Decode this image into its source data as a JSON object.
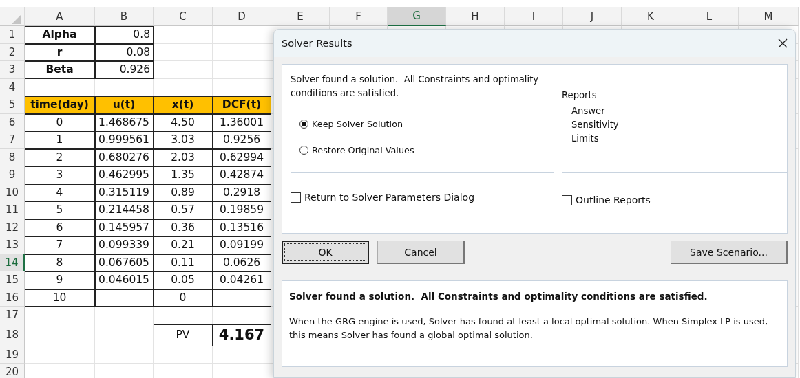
{
  "sheet": {
    "columns": [
      {
        "label": "A",
        "selected": false
      },
      {
        "label": "B",
        "selected": false
      },
      {
        "label": "C",
        "selected": false
      },
      {
        "label": "D",
        "selected": false
      },
      {
        "label": "E",
        "selected": false
      },
      {
        "label": "F",
        "selected": false
      },
      {
        "label": "G",
        "selected": true
      },
      {
        "label": "H",
        "selected": false
      },
      {
        "label": "I",
        "selected": false
      },
      {
        "label": "J",
        "selected": false
      },
      {
        "label": "K",
        "selected": false
      },
      {
        "label": "L",
        "selected": false
      },
      {
        "label": "M",
        "selected": false
      }
    ],
    "rows": [
      {
        "number": "1",
        "kind": "param",
        "selected": false,
        "a": "Alpha",
        "b": "0.8"
      },
      {
        "number": "2",
        "kind": "param",
        "selected": false,
        "a": "r",
        "b": "0.08"
      },
      {
        "number": "3",
        "kind": "param",
        "selected": false,
        "a": "Beta",
        "b": "0.926"
      },
      {
        "number": "4",
        "kind": "blank",
        "selected": false
      },
      {
        "number": "5",
        "kind": "header",
        "selected": false,
        "a": "time(day)",
        "b": "u(t)",
        "c": "x(t)",
        "d": "DCF(t)"
      },
      {
        "number": "6",
        "kind": "data",
        "selected": false,
        "a": "0",
        "b": "1.468675",
        "c": "4.50",
        "d": "1.36001"
      },
      {
        "number": "7",
        "kind": "data",
        "selected": false,
        "a": "1",
        "b": "0.999561",
        "c": "3.03",
        "d": "0.9256"
      },
      {
        "number": "8",
        "kind": "data",
        "selected": false,
        "a": "2",
        "b": "0.680276",
        "c": "2.03",
        "d": "0.62994"
      },
      {
        "number": "9",
        "kind": "data",
        "selected": false,
        "a": "3",
        "b": "0.462995",
        "c": "1.35",
        "d": "0.42874"
      },
      {
        "number": "10",
        "kind": "data",
        "selected": false,
        "a": "4",
        "b": "0.315119",
        "c": "0.89",
        "d": "0.2918"
      },
      {
        "number": "11",
        "kind": "data",
        "selected": false,
        "a": "5",
        "b": "0.214458",
        "c": "0.57",
        "d": "0.19859"
      },
      {
        "number": "12",
        "kind": "data",
        "selected": false,
        "a": "6",
        "b": "0.145957",
        "c": "0.36",
        "d": "0.13516"
      },
      {
        "number": "13",
        "kind": "data",
        "selected": false,
        "a": "7",
        "b": "0.099339",
        "c": "0.21",
        "d": "0.09199"
      },
      {
        "number": "14",
        "kind": "data",
        "selected": true,
        "a": "8",
        "b": "0.067605",
        "c": "0.11",
        "d": "0.0626"
      },
      {
        "number": "15",
        "kind": "data",
        "selected": false,
        "a": "9",
        "b": "0.046015",
        "c": "0.05",
        "d": "0.04261"
      },
      {
        "number": "16",
        "kind": "data",
        "selected": false,
        "a": "10",
        "c": "0"
      },
      {
        "number": "17",
        "kind": "blank",
        "selected": false
      },
      {
        "number": "18",
        "kind": "total",
        "selected": false,
        "c": "PV",
        "d": "4.167"
      },
      {
        "number": "19",
        "kind": "blank",
        "selected": false
      },
      {
        "number": "20",
        "kind": "blank",
        "selected": false
      }
    ]
  },
  "dialog": {
    "title": "Solver Results",
    "message": "Solver found a solution.  All Constraints and optimality conditions are satisfied.",
    "options": [
      {
        "label": "Keep Solver Solution",
        "selected": true
      },
      {
        "label": "Restore Original Values",
        "selected": false
      }
    ],
    "reports_label": "Reports",
    "reports": [
      {
        "label": "Answer",
        "selected": false
      },
      {
        "label": "Sensitivity",
        "selected": false
      },
      {
        "label": "Limits",
        "selected": false
      }
    ],
    "checkboxes": [
      {
        "label": "Return to Solver Parameters Dialog",
        "checked": false
      },
      {
        "label": "Outline Reports",
        "checked": false
      }
    ],
    "buttons": [
      {
        "label": "OK",
        "default": true
      },
      {
        "label": "Cancel",
        "default": false
      },
      {
        "label": "Save Scenario...",
        "default": false
      }
    ],
    "description": {
      "heading": "Solver found a solution.  All Constraints and optimality conditions are satisfied.",
      "text": "When the GRG engine is used, Solver has found at least a local optimal solution. When Simplex LP is used, this means Solver has found a global optimal solution."
    }
  }
}
